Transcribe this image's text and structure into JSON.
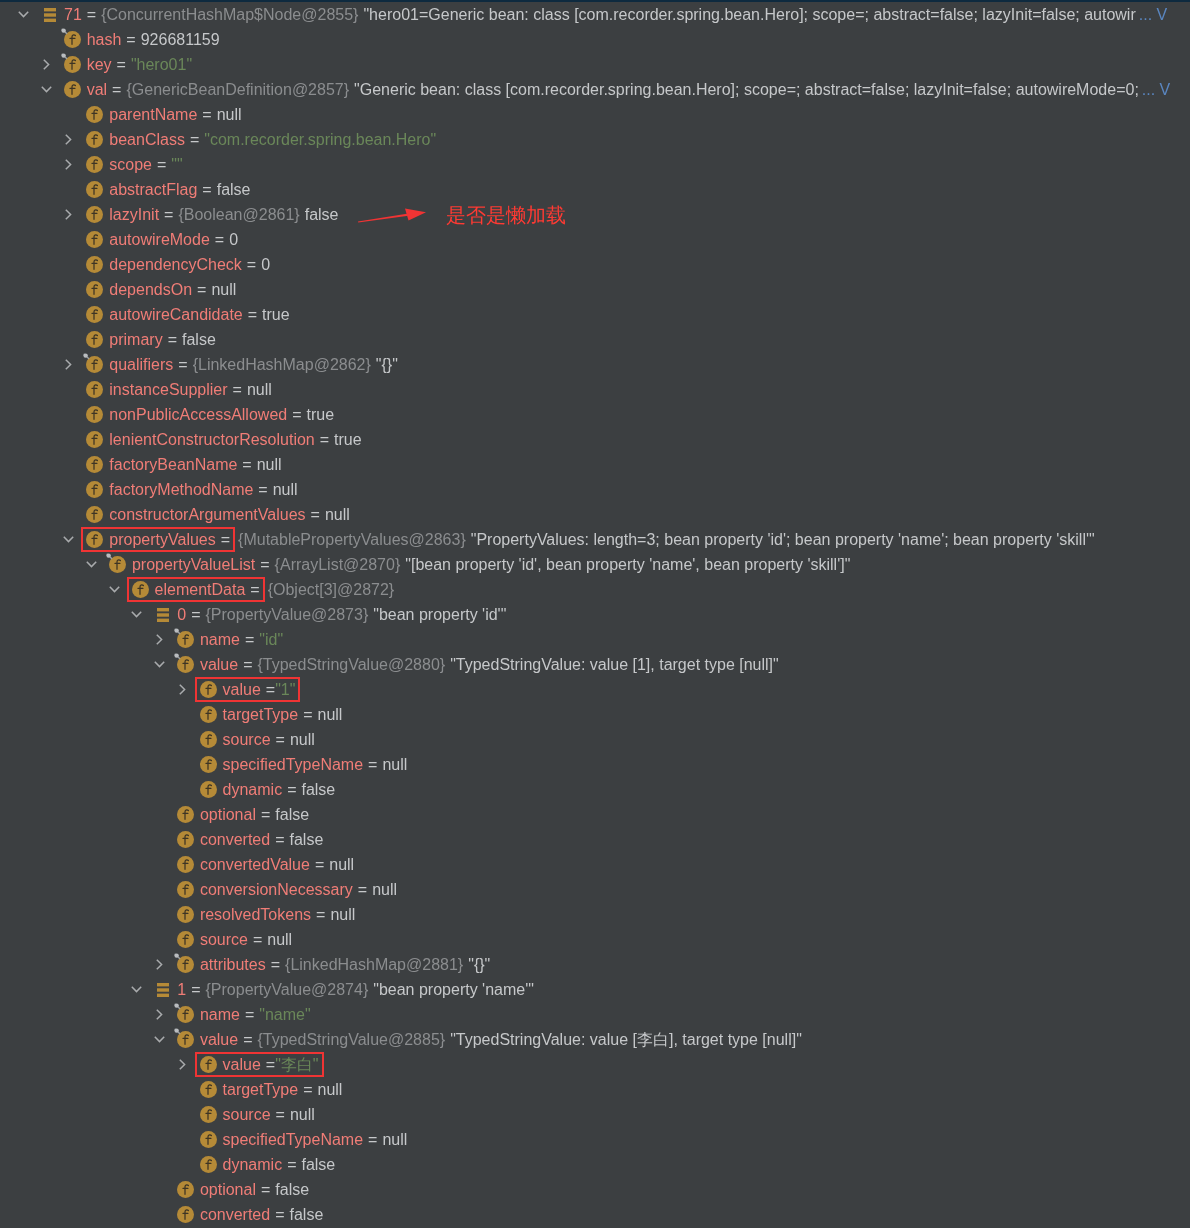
{
  "variables": [
    {
      "kind": "element",
      "name": "71",
      "sign": "=",
      "type": "{ConcurrentHashMap$Node@2855}",
      "value": "\"hero01=Generic bean: class [com.recorder.spring.bean.Hero]; scope=; abstract=false; lazyInit=false; autowir",
      "link": "... V",
      "expanded": true,
      "children": [
        {
          "kind": "field",
          "final": true,
          "name": "hash",
          "sign": "=",
          "value": "926681159"
        },
        {
          "kind": "field",
          "final": true,
          "name": "key",
          "sign": "=",
          "value": "\"hero01\"",
          "string": true,
          "expanded": false
        },
        {
          "kind": "field",
          "name": "val",
          "sign": "=",
          "type": "{GenericBeanDefinition@2857}",
          "value": "\"Generic bean: class [com.recorder.spring.bean.Hero]; scope=; abstract=false; lazyInit=false; autowireMode=0;",
          "link": "... V",
          "expanded": true,
          "children": [
            {
              "kind": "field",
              "name": "parentName",
              "sign": "=",
              "value": "null"
            },
            {
              "kind": "field",
              "name": "beanClass",
              "sign": "=",
              "value": "\"com.recorder.spring.bean.Hero\"",
              "string": true,
              "expanded": false
            },
            {
              "kind": "field",
              "name": "scope",
              "sign": "=",
              "value": "\"\"",
              "string": true,
              "expanded": false
            },
            {
              "kind": "field",
              "name": "abstractFlag",
              "sign": "=",
              "value": "false"
            },
            {
              "kind": "field",
              "name": "lazyInit",
              "sign": "=",
              "type": "{Boolean@2861}",
              "value": "false",
              "expanded": false,
              "note": "是否是懒加载"
            },
            {
              "kind": "field",
              "name": "autowireMode",
              "sign": "=",
              "value": "0"
            },
            {
              "kind": "field",
              "name": "dependencyCheck",
              "sign": "=",
              "value": "0"
            },
            {
              "kind": "field",
              "name": "dependsOn",
              "sign": "=",
              "value": "null"
            },
            {
              "kind": "field",
              "name": "autowireCandidate",
              "sign": "=",
              "value": "true"
            },
            {
              "kind": "field",
              "name": "primary",
              "sign": "=",
              "value": "false"
            },
            {
              "kind": "field",
              "final": true,
              "name": "qualifiers",
              "sign": "=",
              "type": "{LinkedHashMap@2862}",
              "value": "\"{}\"",
              "expanded": false
            },
            {
              "kind": "field",
              "name": "instanceSupplier",
              "sign": "=",
              "value": "null"
            },
            {
              "kind": "field",
              "name": "nonPublicAccessAllowed",
              "sign": "=",
              "value": "true"
            },
            {
              "kind": "field",
              "name": "lenientConstructorResolution",
              "sign": "=",
              "value": "true"
            },
            {
              "kind": "field",
              "name": "factoryBeanName",
              "sign": "=",
              "value": "null"
            },
            {
              "kind": "field",
              "name": "factoryMethodName",
              "sign": "=",
              "value": "null"
            },
            {
              "kind": "field",
              "name": "constructorArgumentValues",
              "sign": "=",
              "value": "null"
            },
            {
              "kind": "field",
              "name": "propertyValues",
              "sign": "=",
              "type": "{MutablePropertyValues@2863}",
              "value": "\"PropertyValues: length=3; bean property 'id'; bean property 'name'; bean property 'skill'\"",
              "expanded": true,
              "boxed": true,
              "children": [
                {
                  "kind": "field",
                  "final": true,
                  "name": "propertyValueList",
                  "sign": "=",
                  "type": "{ArrayList@2870}",
                  "value": "\"[bean property 'id', bean property 'name', bean property 'skill']\"",
                  "expanded": true,
                  "children": [
                    {
                      "kind": "field",
                      "name": "elementData",
                      "sign": "=",
                      "type": "{Object[3]@2872}",
                      "expanded": true,
                      "boxed": true,
                      "children": [
                        {
                          "kind": "element",
                          "name": "0",
                          "sign": "=",
                          "type": "{PropertyValue@2873}",
                          "value": "\"bean property 'id'\"",
                          "expanded": true,
                          "children": [
                            {
                              "kind": "field",
                              "final": true,
                              "name": "name",
                              "sign": "=",
                              "value": "\"id\"",
                              "string": true,
                              "expanded": false
                            },
                            {
                              "kind": "field",
                              "final": true,
                              "name": "value",
                              "sign": "=",
                              "type": "{TypedStringValue@2880}",
                              "value": "\"TypedStringValue: value [1], target type [null]\"",
                              "expanded": true,
                              "children": [
                                {
                                  "kind": "field",
                                  "name": "value",
                                  "sign": "=",
                                  "value": "\"1\"",
                                  "string": true,
                                  "expanded": false,
                                  "boxed": true
                                },
                                {
                                  "kind": "field",
                                  "name": "targetType",
                                  "sign": "=",
                                  "value": "null"
                                },
                                {
                                  "kind": "field",
                                  "name": "source",
                                  "sign": "=",
                                  "value": "null"
                                },
                                {
                                  "kind": "field",
                                  "name": "specifiedTypeName",
                                  "sign": "=",
                                  "value": "null"
                                },
                                {
                                  "kind": "field",
                                  "name": "dynamic",
                                  "sign": "=",
                                  "value": "false"
                                }
                              ]
                            },
                            {
                              "kind": "field",
                              "name": "optional",
                              "sign": "=",
                              "value": "false"
                            },
                            {
                              "kind": "field",
                              "name": "converted",
                              "sign": "=",
                              "value": "false"
                            },
                            {
                              "kind": "field",
                              "name": "convertedValue",
                              "sign": "=",
                              "value": "null"
                            },
                            {
                              "kind": "field",
                              "name": "conversionNecessary",
                              "sign": "=",
                              "value": "null"
                            },
                            {
                              "kind": "field",
                              "name": "resolvedTokens",
                              "sign": "=",
                              "value": "null"
                            },
                            {
                              "kind": "field",
                              "name": "source",
                              "sign": "=",
                              "value": "null"
                            },
                            {
                              "kind": "field",
                              "final": true,
                              "name": "attributes",
                              "sign": "=",
                              "type": "{LinkedHashMap@2881}",
                              "value": "\"{}\"",
                              "expanded": false
                            }
                          ]
                        },
                        {
                          "kind": "element",
                          "name": "1",
                          "sign": "=",
                          "type": "{PropertyValue@2874}",
                          "value": "\"bean property 'name'\"",
                          "expanded": true,
                          "children": [
                            {
                              "kind": "field",
                              "final": true,
                              "name": "name",
                              "sign": "=",
                              "value": "\"name\"",
                              "string": true,
                              "expanded": false
                            },
                            {
                              "kind": "field",
                              "final": true,
                              "name": "value",
                              "sign": "=",
                              "type": "{TypedStringValue@2885}",
                              "value": "\"TypedStringValue: value [李白], target type [null]\"",
                              "expanded": true,
                              "children": [
                                {
                                  "kind": "field",
                                  "name": "value",
                                  "sign": "=",
                                  "value": "\"李白\"",
                                  "string": true,
                                  "expanded": false,
                                  "boxed": true
                                },
                                {
                                  "kind": "field",
                                  "name": "targetType",
                                  "sign": "=",
                                  "value": "null"
                                },
                                {
                                  "kind": "field",
                                  "name": "source",
                                  "sign": "=",
                                  "value": "null"
                                },
                                {
                                  "kind": "field",
                                  "name": "specifiedTypeName",
                                  "sign": "=",
                                  "value": "null"
                                },
                                {
                                  "kind": "field",
                                  "name": "dynamic",
                                  "sign": "=",
                                  "value": "false"
                                }
                              ]
                            },
                            {
                              "kind": "field",
                              "name": "optional",
                              "sign": "=",
                              "value": "false"
                            },
                            {
                              "kind": "field",
                              "name": "converted",
                              "sign": "=",
                              "value": "false"
                            }
                          ]
                        }
                      ]
                    }
                  ]
                }
              ]
            }
          ]
        }
      ]
    }
  ]
}
